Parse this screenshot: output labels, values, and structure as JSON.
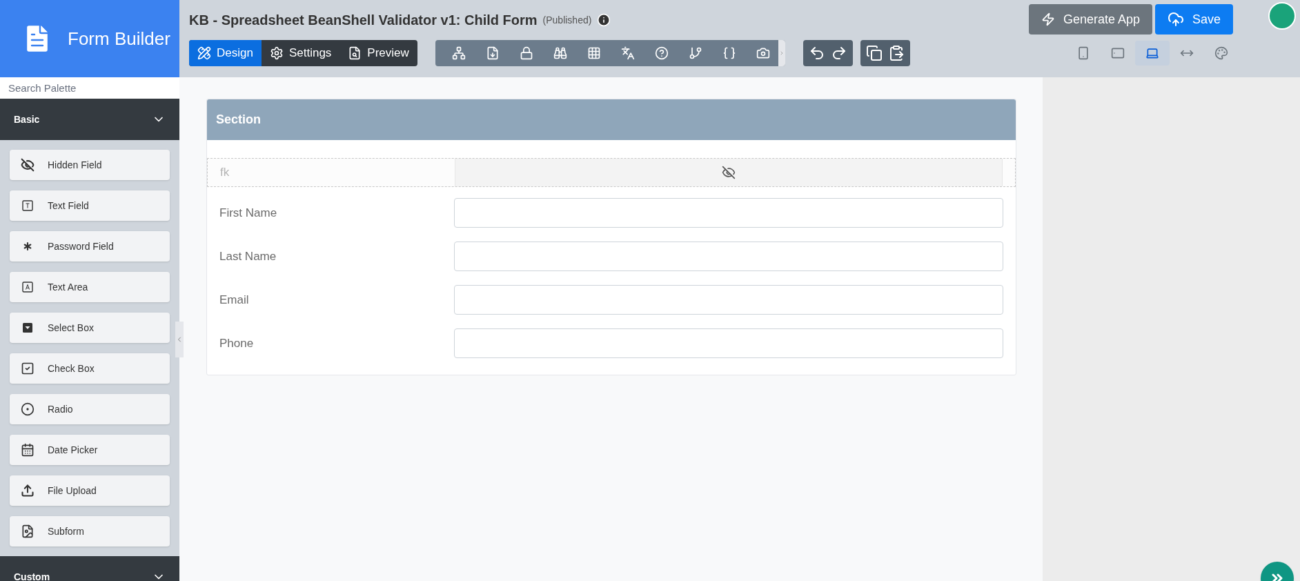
{
  "app": {
    "title": "Form Builder"
  },
  "palette": {
    "search_placeholder": "Search Palette",
    "groups": [
      {
        "title": "Basic",
        "expanded": true,
        "items": [
          {
            "label": "Hidden Field",
            "kind": "hidden"
          },
          {
            "label": "Text Field",
            "kind": "text"
          },
          {
            "label": "Password Field",
            "kind": "password"
          },
          {
            "label": "Text Area",
            "kind": "textarea"
          },
          {
            "label": "Select Box",
            "kind": "select"
          },
          {
            "label": "Check Box",
            "kind": "checkbox"
          },
          {
            "label": "Radio",
            "kind": "radio"
          },
          {
            "label": "Date Picker",
            "kind": "date"
          },
          {
            "label": "File Upload",
            "kind": "upload"
          },
          {
            "label": "Subform",
            "kind": "subform"
          }
        ]
      },
      {
        "title": "Custom",
        "expanded": false
      }
    ]
  },
  "header": {
    "title": "KB - Spreadsheet BeanShell Validator v1: Child Form",
    "status": "(Published)"
  },
  "mode_tabs": [
    {
      "label": "Design",
      "selected": true,
      "kind": "design"
    },
    {
      "label": "Settings",
      "selected": false,
      "kind": "settings"
    },
    {
      "label": "Preview",
      "selected": false,
      "kind": "preview"
    }
  ],
  "actions": [
    {
      "label": "Generate App",
      "kind": "generate"
    },
    {
      "label": "Save",
      "kind": "save"
    }
  ],
  "device_views": [
    {
      "kind": "phone",
      "selected": false
    },
    {
      "kind": "tablet",
      "selected": false
    },
    {
      "kind": "laptop",
      "selected": true
    },
    {
      "kind": "full",
      "selected": false
    },
    {
      "kind": "theme",
      "selected": false
    }
  ],
  "section": {
    "title": "Section",
    "fields": [
      {
        "label": "fk",
        "kind": "hidden"
      },
      {
        "label": "First Name",
        "kind": "text"
      },
      {
        "label": "Last Name",
        "kind": "text"
      },
      {
        "label": "Email",
        "kind": "text"
      },
      {
        "label": "Phone",
        "kind": "text"
      }
    ]
  }
}
